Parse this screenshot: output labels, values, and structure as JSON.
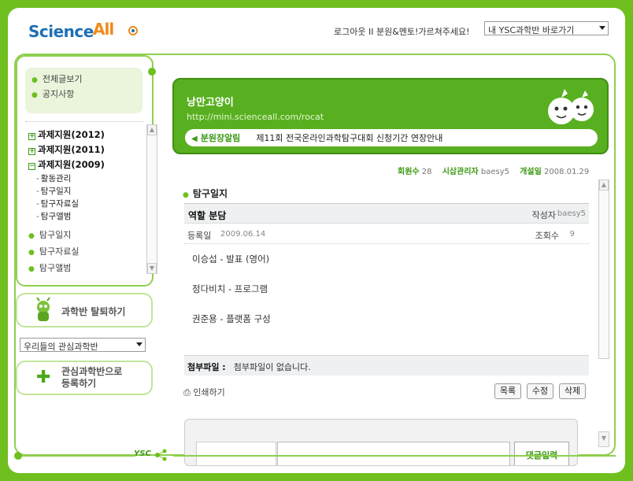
{
  "header": {
    "logo_science": "Science",
    "logo_all": "All",
    "logout": "로그아웃",
    "separator": " II ",
    "mentor_link": "분원&멘토!가르쳐주세요!",
    "ysc_select": "내 YSC과학반 바로가기"
  },
  "sidebar": {
    "quick_links": [
      {
        "label": "전체글보기"
      },
      {
        "label": "공지사항"
      }
    ],
    "categories": [
      {
        "sign": "+",
        "label": "과제지원(2012)"
      },
      {
        "sign": "+",
        "label": "과제지원(2011)"
      },
      {
        "sign": "−",
        "label": "과제지원(2009)"
      }
    ],
    "sub_items": [
      {
        "label": "활동관리"
      },
      {
        "label": "탐구일지"
      },
      {
        "label": "탐구자료실"
      },
      {
        "label": "탐구앨범"
      }
    ],
    "items": [
      {
        "label": "탐구일지"
      },
      {
        "label": "탐구자료실"
      },
      {
        "label": "탐구앨범"
      }
    ],
    "leave_button": "과학반 탈퇴하기",
    "interest_select": "우리들의 관심과학반",
    "register_button_line1": "관심과학반으로",
    "register_button_line2": "등록하기"
  },
  "banner": {
    "title": "낭만고양이",
    "url": "http://mini.scienceall.com/rocat",
    "notice_label": "분원장알림",
    "notice_text": "제11회 전국온라인과학탐구대회 신청기간 연장안내"
  },
  "meta": {
    "members_label": "회원수",
    "members_value": "28",
    "admin_label": "시삽관리자",
    "admin_value": "baesy5",
    "opened_label": "개설일",
    "opened_value": "2008.01.29"
  },
  "board": {
    "section_title": "탐구일지",
    "post_title": "역할 분담",
    "writer_label": "작성자",
    "writer_value": "baesy5",
    "date_label": "등록일",
    "date_value": "2009.06.14",
    "views_label": "조회수",
    "views_value": "9",
    "body_lines": [
      "이승섭 - 발표 (영어)",
      "정다비치 - 프로그램",
      "권준용 - 플랫폼 구성"
    ],
    "attach_label": "첨부파일 :",
    "attach_value": "첨부파일이 없습니다.",
    "print_label": "인쇄하기",
    "list_button": "목록",
    "edit_button": "수정",
    "delete_button": "삭제",
    "comment_button": "댓글입력"
  },
  "footer": {
    "ysc": "YSC"
  },
  "colors": {
    "brand_green": "#6fbf1f",
    "banner_green": "#58b020",
    "logo_blue": "#1e6fb5",
    "logo_orange": "#f08a1c"
  }
}
